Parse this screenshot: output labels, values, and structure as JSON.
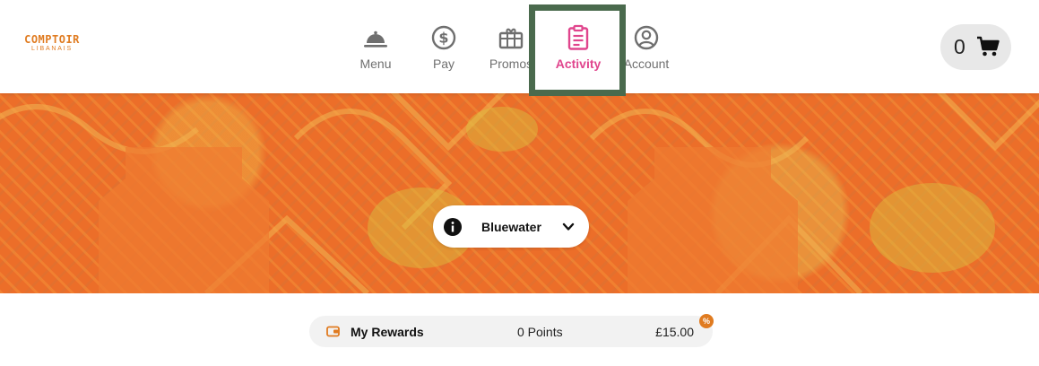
{
  "logo": {
    "main": "COMPTOIR",
    "sub": "LIBANAIS"
  },
  "nav": {
    "items": [
      {
        "label": "Menu",
        "icon": "cloche-icon"
      },
      {
        "label": "Pay",
        "icon": "dollar-circle-icon"
      },
      {
        "label": "Promos",
        "icon": "gift-icon"
      },
      {
        "label": "Activity",
        "icon": "clipboard-icon",
        "active": true
      },
      {
        "label": "Account",
        "icon": "user-circle-icon"
      }
    ]
  },
  "cart": {
    "count": "0",
    "icon": "cart-icon"
  },
  "location": {
    "name": "Bluewater",
    "info_icon": "info-icon",
    "chevron_icon": "chevron-down-icon"
  },
  "rewards": {
    "label": "My Rewards",
    "points": "0 Points",
    "amount": "£15.00",
    "badge": "%",
    "icon": "wallet-icon"
  },
  "colors": {
    "accent": "#e0458d",
    "brand": "#e07b20",
    "banner": "#ec6e29",
    "highlight": "#4a6a4d"
  }
}
